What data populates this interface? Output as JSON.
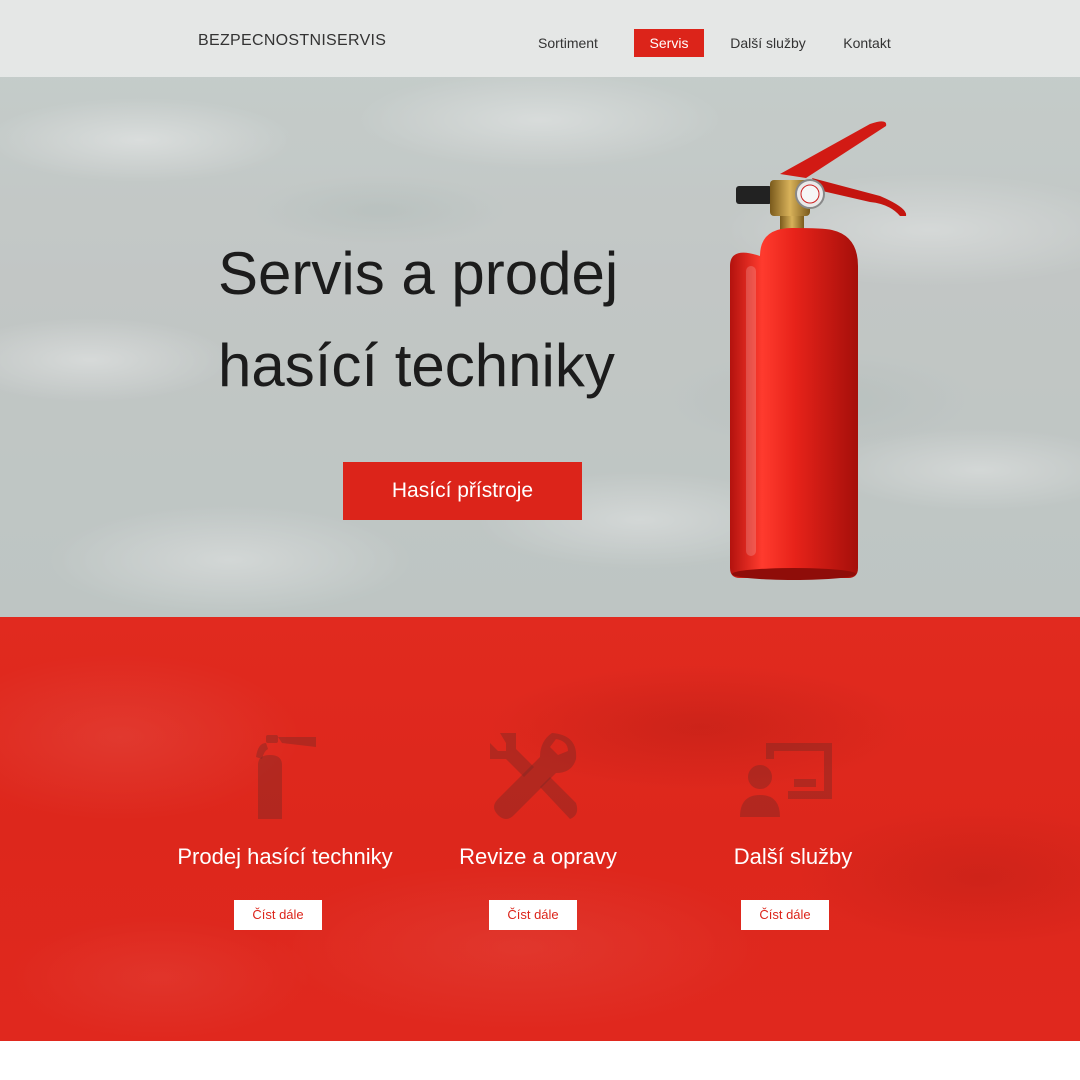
{
  "nav": {
    "logo": "BEZPECNOSTNISERVIS",
    "items": [
      {
        "label": "Sortiment",
        "active": false
      },
      {
        "label": "Servis",
        "active": true
      },
      {
        "label": "Další služby",
        "active": false
      },
      {
        "label": "Kontakt",
        "active": false
      }
    ]
  },
  "hero": {
    "title_line1": "Servis a prodej",
    "title_line2": "hasící techniky",
    "button_label": "Hasící přístroje"
  },
  "services": [
    {
      "title": "Prodej hasící techniky",
      "button_label": "Číst dále",
      "icon": "fire-extinguisher-icon"
    },
    {
      "title": "Revize a opravy",
      "button_label": "Číst dále",
      "icon": "tools-icon"
    },
    {
      "title": "Další služby",
      "button_label": "Číst dále",
      "icon": "presenter-icon"
    }
  ],
  "colors": {
    "accent": "#dc241a",
    "nav_background": "#ebedec",
    "hero_text": "#1c1c1c",
    "section_background": "#e12a1f"
  }
}
